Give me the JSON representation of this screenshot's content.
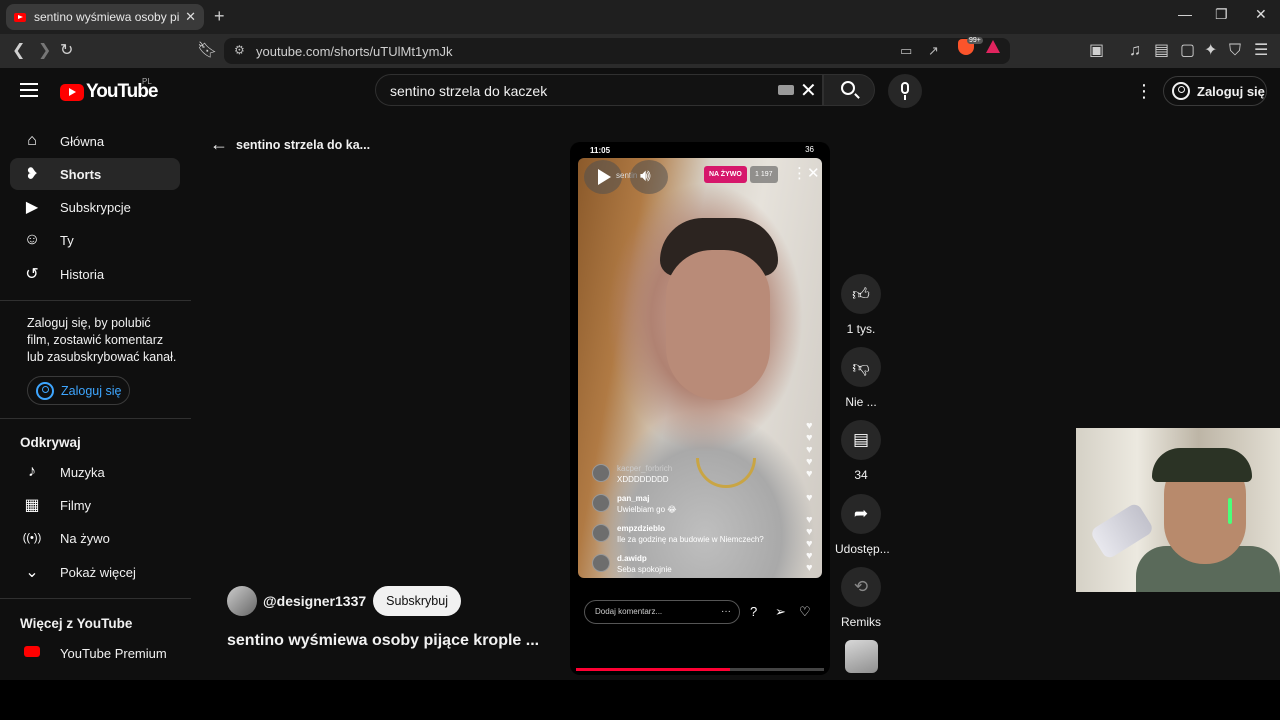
{
  "browser": {
    "tab_title": "sentino wyśmiewa osoby pijące krople",
    "tab_close": "✕",
    "new_tab": "+",
    "window_controls": [
      "—",
      "❐",
      "✕"
    ],
    "url": "youtube.com/shorts/uTUlMt1ymJk",
    "extension_badge": "99+"
  },
  "masthead": {
    "logo_text": "YouTube",
    "region": "PL",
    "search_value": "sentino strzela do kaczek",
    "signin_label": "Zaloguj się",
    "kebab": "⋮"
  },
  "sidebar": {
    "items": [
      {
        "label": "Główna",
        "icon": "home-icon",
        "glyph": "⌂"
      },
      {
        "label": "Shorts",
        "icon": "shorts-icon",
        "glyph": "❥"
      },
      {
        "label": "Subskrypcje",
        "icon": "subscriptions-icon",
        "glyph": "▶"
      },
      {
        "label": "Ty",
        "icon": "you-icon",
        "glyph": "☺"
      },
      {
        "label": "Historia",
        "icon": "history-icon",
        "glyph": "↺"
      }
    ],
    "signin_note": "Zaloguj się, by polubić film, zostawić komentarz lub zasubskrybować kanał.",
    "signin_label": "Zaloguj się",
    "explore_title": "Odkrywaj",
    "explore": [
      {
        "label": "Muzyka",
        "icon": "music-icon",
        "glyph": "♪"
      },
      {
        "label": "Filmy",
        "icon": "movies-icon",
        "glyph": "▦"
      },
      {
        "label": "Na żywo",
        "icon": "live-icon",
        "glyph": "((•))"
      },
      {
        "label": "Pokaż więcej",
        "icon": "chevron-down-icon",
        "glyph": "⌄"
      }
    ],
    "more_title": "Więcej z YouTube",
    "more": [
      {
        "label": "YouTube Premium",
        "icon": "youtube-premium-icon"
      }
    ]
  },
  "content": {
    "back_label": "sentino strzela do ka...",
    "channel": "@designer1337",
    "subscribe": "Subskrybuj",
    "title": "sentino wyśmiewa osoby pijące krople ..."
  },
  "player": {
    "time": "11:05",
    "battery": "36",
    "account": "sentin",
    "live_badge": "NA ŻYWO",
    "viewers": "1 197",
    "comment_placeholder": "Dodaj komentarz...",
    "comment_dots": "···",
    "progress": 0.62,
    "comments": [
      {
        "user": "kacper_forbrich",
        "text": "XDDDDDDDD"
      },
      {
        "user": "pan_maj",
        "text": "Uwielbiam go 😂"
      },
      {
        "user": "empzdzieblo",
        "text": "Ile za godzinę na budowie w Niemczech?"
      },
      {
        "user": "d.awidp",
        "text": "Seba spokojnie"
      }
    ]
  },
  "actions": {
    "like": "1 tys.",
    "dislike": "Nie ...",
    "comments": "34",
    "share": "Udostęp...",
    "remix": "Remiks"
  }
}
